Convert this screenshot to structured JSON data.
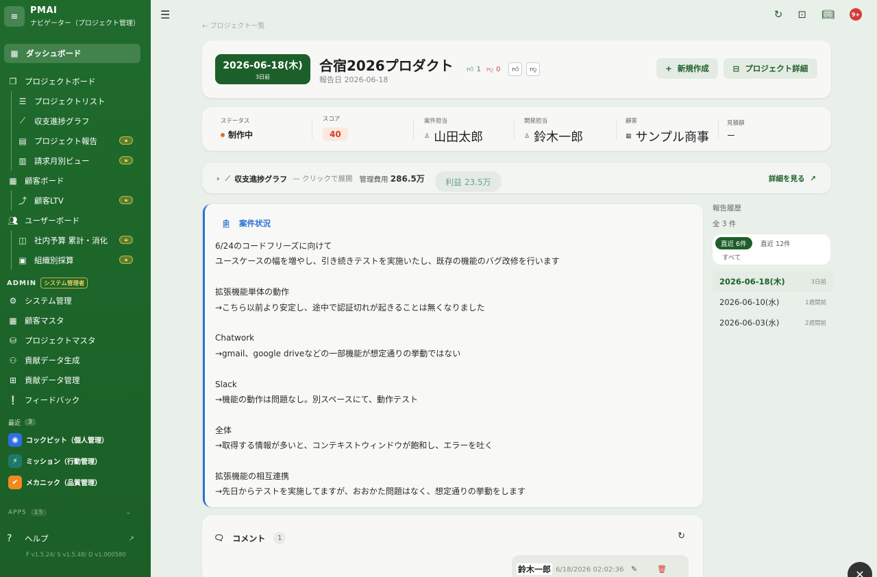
{
  "brand": {
    "name": "PMAI",
    "subtitle": "ナビゲーター（プロジェクト管理）",
    "icon": "list-icon"
  },
  "sidebar": {
    "items": [
      {
        "label": "ダッシュボード",
        "icon": "grid-icon",
        "active": true
      },
      {
        "label": "プロジェクトボード",
        "icon": "board-icon"
      },
      {
        "label": "プロジェクトリスト",
        "icon": "list-icon",
        "sub": true
      },
      {
        "label": "収支進捗グラフ",
        "icon": "chart-icon",
        "sub": true
      },
      {
        "label": "プロジェクト報告",
        "icon": "doc-icon",
        "sub": true,
        "locked": true
      },
      {
        "label": "請求月別ビュー",
        "icon": "building-icon",
        "sub": true,
        "locked": true
      },
      {
        "label": "顧客ボード",
        "icon": "table-icon"
      },
      {
        "label": "顧客LTV",
        "icon": "trend-icon",
        "sub": true,
        "locked": true
      },
      {
        "label": "ユーザーボード",
        "icon": "users-icon"
      },
      {
        "label": "社内予算 累計・消化",
        "icon": "wallet-icon",
        "sub": true,
        "locked": true
      },
      {
        "label": "組織別採算",
        "icon": "image-icon",
        "sub": true,
        "locked": true
      }
    ],
    "admin_label": "ADMIN",
    "admin_badge": "システム管理者",
    "admin_items": [
      {
        "label": "システム管理",
        "icon": "gear-icon"
      },
      {
        "label": "顧客マスタ",
        "icon": "table-icon"
      },
      {
        "label": "プロジェクトマスタ",
        "icon": "database-icon"
      },
      {
        "label": "貢献データ生成",
        "icon": "user-gear-icon"
      },
      {
        "label": "貢献データ管理",
        "icon": "grid-gear-icon"
      },
      {
        "label": "フィードバック",
        "icon": "feedback-icon"
      }
    ],
    "recent_label": "最近",
    "recent_count": "3",
    "recent_apps": [
      {
        "label": "コックピット（個人管理）",
        "icon": "cockpit-icon",
        "color": "#2f6fe0"
      },
      {
        "label": "ミッション（行動管理）",
        "icon": "bolt-icon",
        "color": "#1d7a6a"
      },
      {
        "label": "メカニック（品質管理）",
        "icon": "check-icon",
        "color": "#f08a1c"
      }
    ],
    "apps_label": "APPS",
    "apps_count": "15",
    "help_label": "ヘルプ",
    "version": "F v1.5.24/ S v1.5.48/ D v1.000580"
  },
  "topbar": {
    "breadcrumb": "← プロジェクト一覧",
    "notification_count": "9+"
  },
  "header": {
    "date": "2026-06-18(木)",
    "ago": "3日前",
    "title": "合宿2026プロダクト",
    "report_date": "報告日 2026-06-18",
    "likes": "1",
    "dislikes": "0",
    "new_button": "新規作成",
    "detail_button": "プロジェクト詳細"
  },
  "info": {
    "status_label": "ステータス",
    "status_value": "制作中",
    "score_label": "スコア",
    "score_value": "40",
    "case_owner_label": "案件担当",
    "case_owner": "山田太郎",
    "dev_owner_label": "開発担当",
    "dev_owner": "鈴木一郎",
    "client_label": "顧客",
    "client": "サンプル商事",
    "estimate_label": "見積額",
    "estimate": "ー"
  },
  "graph": {
    "title": "収支進捗グラフ",
    "hint": "— クリックで展開",
    "cost_label": "管理費用",
    "cost_value": "286.5万",
    "profit": "利益 23.5万",
    "more": "詳細を見る"
  },
  "status_card": {
    "title": "案件状況",
    "lines": [
      "6/24のコードフリーズに向けて",
      "ユースケースの幅を増やし、引き続きテストを実施いたし、既存の機能のバグ改修を行います",
      "",
      "拡張機能単体の動作",
      "→こちら以前より安定し、途中で認証切れが起きることは無くなりました",
      "",
      "Chatwork",
      "→gmail、google driveなどの一部機能が想定通りの挙動ではない",
      "",
      "Slack",
      "→機能の動作は問題なし。別スペースにて、動作テスト",
      "",
      "全体",
      "→取得する情報が多いと、コンテキストウィンドウが飽和し、エラーを吐く",
      "",
      "拡張機能の相互連携",
      "→先日からテストを実施してますが、おおかた問題はなく、想定通りの挙動をします"
    ]
  },
  "history": {
    "title": "報告履歴",
    "count": "全 3 件",
    "tab_recent6": "直近 6件",
    "tab_recent12": "直近 12件",
    "tab_all": "すべて",
    "items": [
      {
        "date": "2026-06-18(木)",
        "ago": "3日前",
        "selected": true
      },
      {
        "date": "2026-06-10(水)",
        "ago": "1週間前"
      },
      {
        "date": "2026-06-03(水)",
        "ago": "2週間前"
      }
    ]
  },
  "comments": {
    "title": "コメント",
    "count": "1",
    "items": [
      {
        "author": "鈴木一郎",
        "time": "6/18/2026 02:02:36"
      }
    ]
  }
}
